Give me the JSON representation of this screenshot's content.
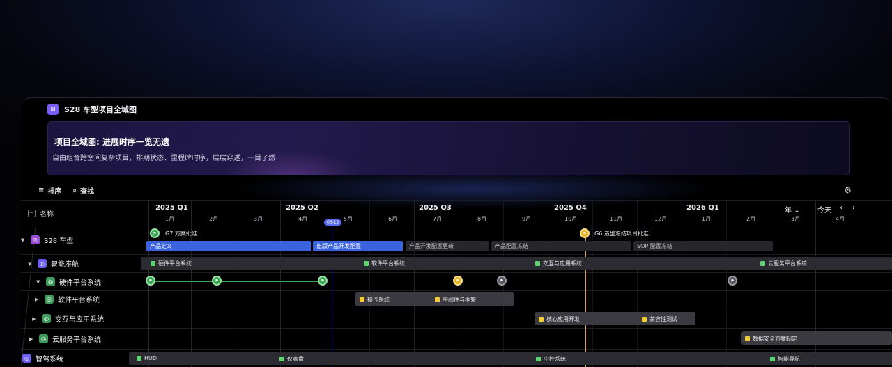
{
  "window": {
    "title": "S28 车型项目全域图",
    "icon": "grid-icon"
  },
  "banner": {
    "heading": "项目全域图: 进展时序一览无遗",
    "description": "自由组合跨空间复杂项目，排期状态、里程碑时序，层层穿透，一目了然"
  },
  "toolbar": {
    "sort_label": "排序",
    "search_label": "查找",
    "settings_icon": "sliders-icon"
  },
  "tree": {
    "header": "名称",
    "nodes": [
      {
        "label": "S28 车型",
        "icon": "purple"
      },
      {
        "label": "智能座舱",
        "icon": "indigo"
      },
      {
        "label": "硬件平台系统",
        "icon": "green"
      },
      {
        "label": "软件平台系统",
        "icon": "green"
      },
      {
        "label": "交互与应用系统",
        "icon": "green"
      },
      {
        "label": "云服务平台系统",
        "icon": "green"
      },
      {
        "label": "智驾系统",
        "icon": "indigo"
      }
    ]
  },
  "timeline": {
    "quarters": [
      "2025 Q1",
      "2025 Q2",
      "2025 Q3",
      "2025 Q4",
      "2026 Q1"
    ],
    "months": [
      "1月",
      "2月",
      "3月",
      "4月",
      "5月",
      "6月",
      "7月",
      "8月",
      "9月",
      "10月",
      "11月",
      "12月",
      "1月",
      "2月",
      "3月",
      "4月"
    ],
    "scale_label": "年",
    "today_label": "今天",
    "today_marker": "05-12"
  },
  "milestones": {
    "g7": "G7 方案批准",
    "g6": "G6 造型冻结项目批准"
  },
  "s28_bars": [
    "产品定义",
    "出版产品开发配置",
    "产品开发配置更新",
    "产品配置冻结",
    "SOP 配置冻结"
  ],
  "cockpit_chips": [
    "硬件平台系统",
    "软件平台系统",
    "交互与应用系统",
    "云服务平台系统"
  ],
  "software_tasks": [
    "操作系统",
    "中间件与框架"
  ],
  "interaction_tasks": [
    "核心应用开发",
    "兼容性测试"
  ],
  "cloud_tasks": [
    "数据安全方案制定"
  ],
  "adas_chips": [
    "HUD",
    "仪表盘",
    "中控系统",
    "智能导航"
  ],
  "colors": {
    "accent_blue": "#3b63e0",
    "green": "#3aa84f",
    "yellow": "#e7b32b",
    "today": "#5b6cf0"
  }
}
